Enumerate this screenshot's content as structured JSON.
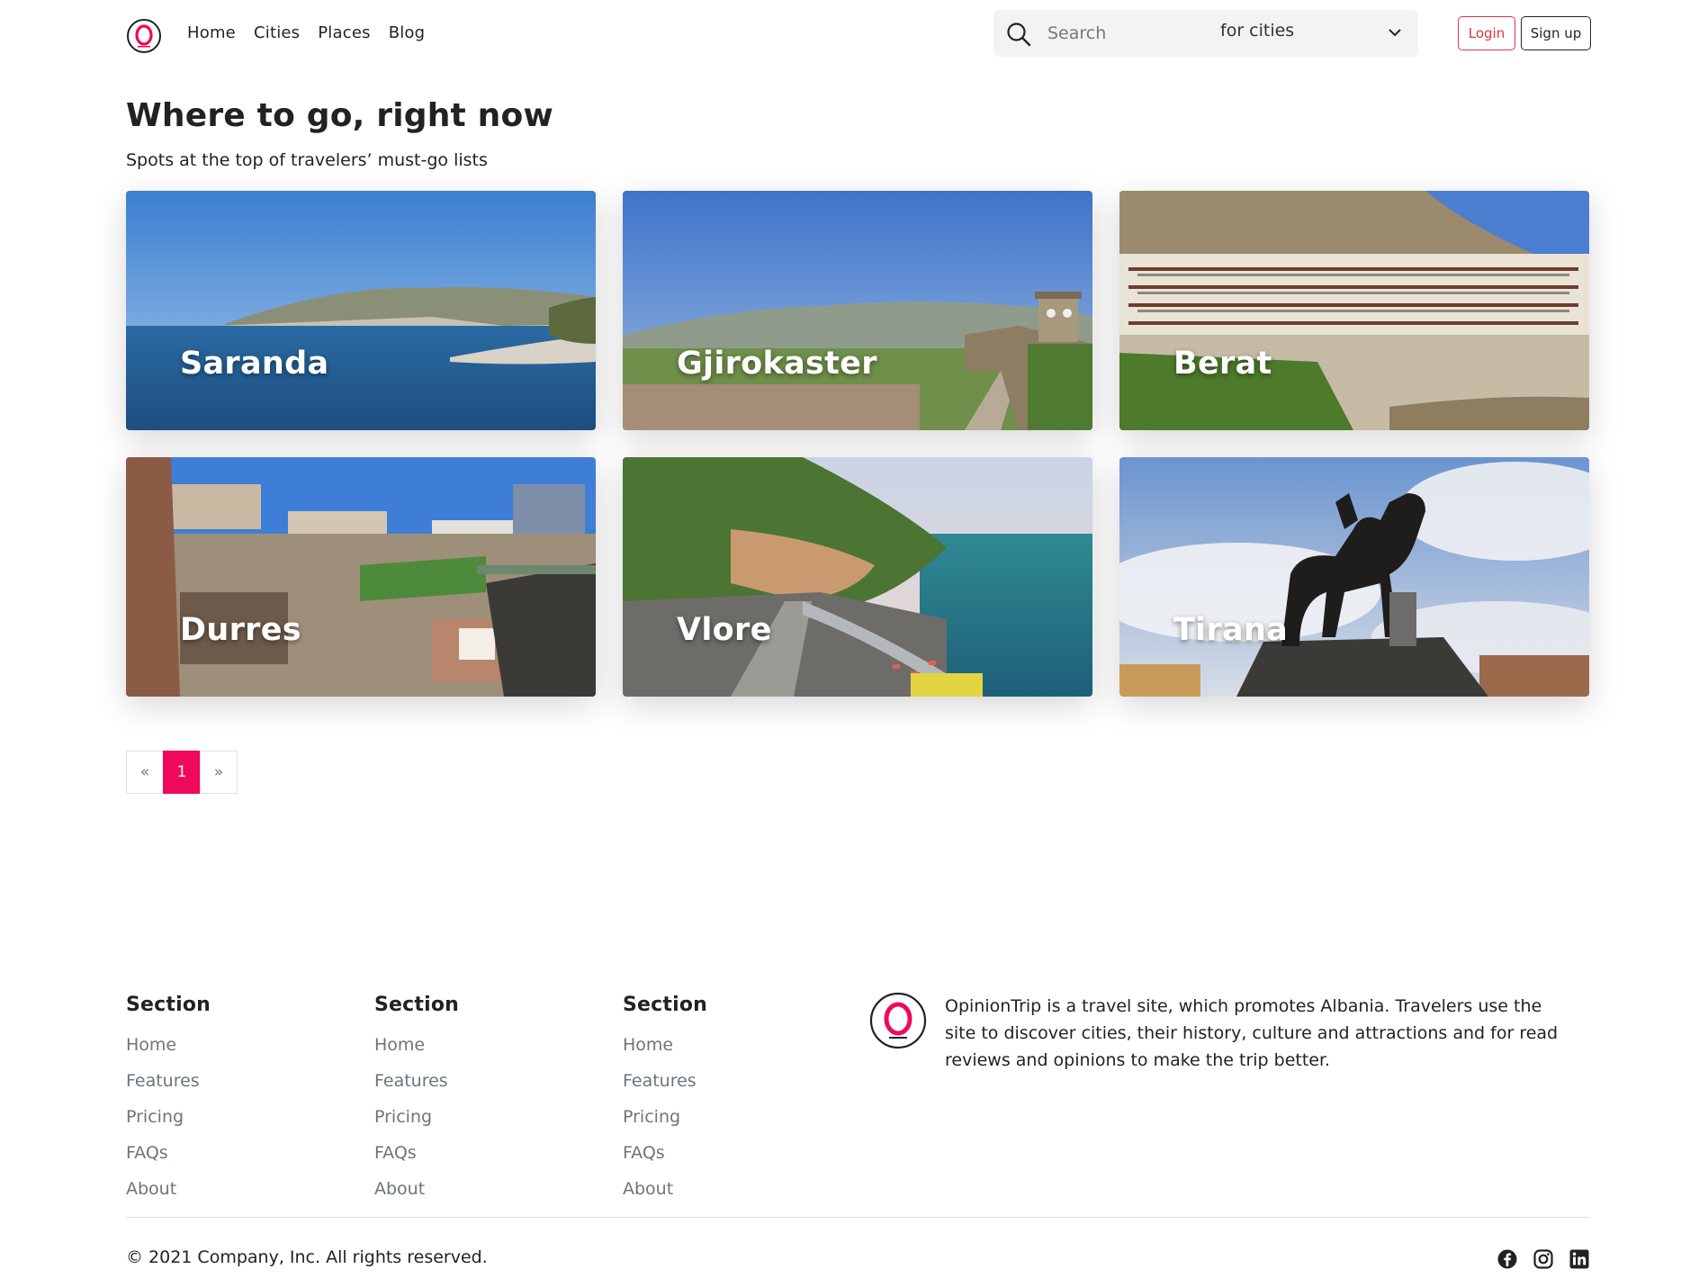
{
  "brand": {
    "accent": "#f0095a",
    "logo_letter": "O"
  },
  "nav": {
    "links": [
      "Home",
      "Cities",
      "Places",
      "Blog"
    ],
    "search": {
      "placeholder": "Search",
      "scope": "for cities"
    },
    "login_label": "Login",
    "signup_label": "Sign up"
  },
  "hero": {
    "title": "Where to go, right now",
    "subtitle": "Spots at the top of travelers’ must-go lists"
  },
  "cities": [
    {
      "name": "Saranda"
    },
    {
      "name": "Gjirokaster"
    },
    {
      "name": "Berat"
    },
    {
      "name": "Durres"
    },
    {
      "name": "Vlore"
    },
    {
      "name": "Tirana"
    }
  ],
  "pagination": {
    "prev": "«",
    "current": "1",
    "next": "»"
  },
  "footer": {
    "columns": [
      {
        "heading": "Section",
        "links": [
          "Home",
          "Features",
          "Pricing",
          "FAQs",
          "About"
        ]
      },
      {
        "heading": "Section",
        "links": [
          "Home",
          "Features",
          "Pricing",
          "FAQs",
          "About"
        ]
      },
      {
        "heading": "Section",
        "links": [
          "Home",
          "Features",
          "Pricing",
          "FAQs",
          "About"
        ]
      }
    ],
    "about": "OpinionTrip is a travel site, which promotes Albania. Travelers use the site to discover cities, their history, culture and attractions and for read reviews and opinions to make the trip better.",
    "copyright": "© 2021 Company, Inc. All rights reserved.",
    "social_icons": [
      "facebook-icon",
      "instagram-icon",
      "linkedin-icon"
    ]
  }
}
